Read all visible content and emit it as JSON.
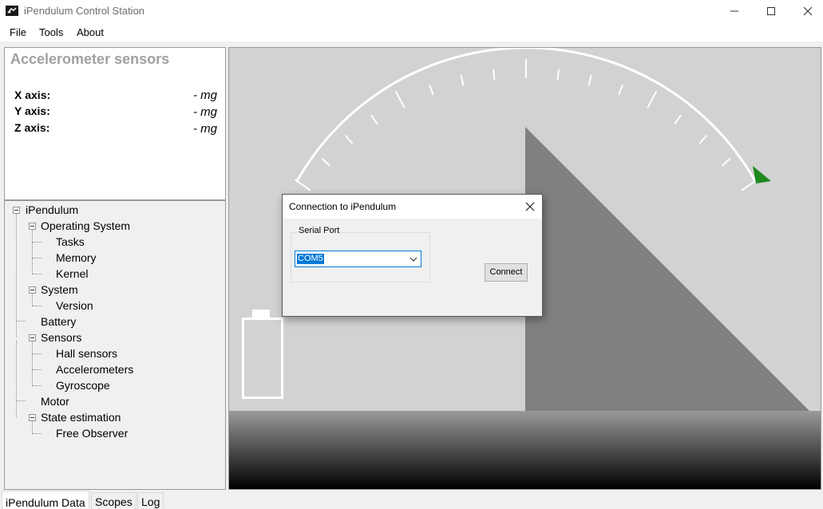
{
  "window": {
    "title": "iPendulum Control Station",
    "icon": "app-logo-icon"
  },
  "menu": {
    "file": "File",
    "tools": "Tools",
    "about": "About"
  },
  "sensors": {
    "title": "Accelerometer sensors",
    "x_label": "X axis:",
    "y_label": "Y axis:",
    "z_label": "Z axis:",
    "x_value": "- mg",
    "y_value": "- mg",
    "z_value": "- mg"
  },
  "tree": {
    "root": "iPendulum",
    "operating_system": "Operating System",
    "tasks": "Tasks",
    "memory": "Memory",
    "kernel": "Kernel",
    "system": "System",
    "version": "Version",
    "battery": "Battery",
    "sensors": "Sensors",
    "hall_sensors": "Hall sensors",
    "accelerometers": "Accelerometers",
    "gyroscope": "Gyroscope",
    "motor": "Motor",
    "state_estimation": "State estimation",
    "free_observer": "Free Observer"
  },
  "dialog": {
    "title": "Connection to iPendulum",
    "group_label": "Serial Port",
    "port_value": "COM5",
    "connect_label": "Connect"
  },
  "tabs": {
    "data": "iPendulum Data",
    "scopes": "Scopes",
    "log": "Log"
  },
  "colors": {
    "pointer": "#1f8a1f",
    "ramp": "#808080",
    "background": "#d2d2d2"
  }
}
